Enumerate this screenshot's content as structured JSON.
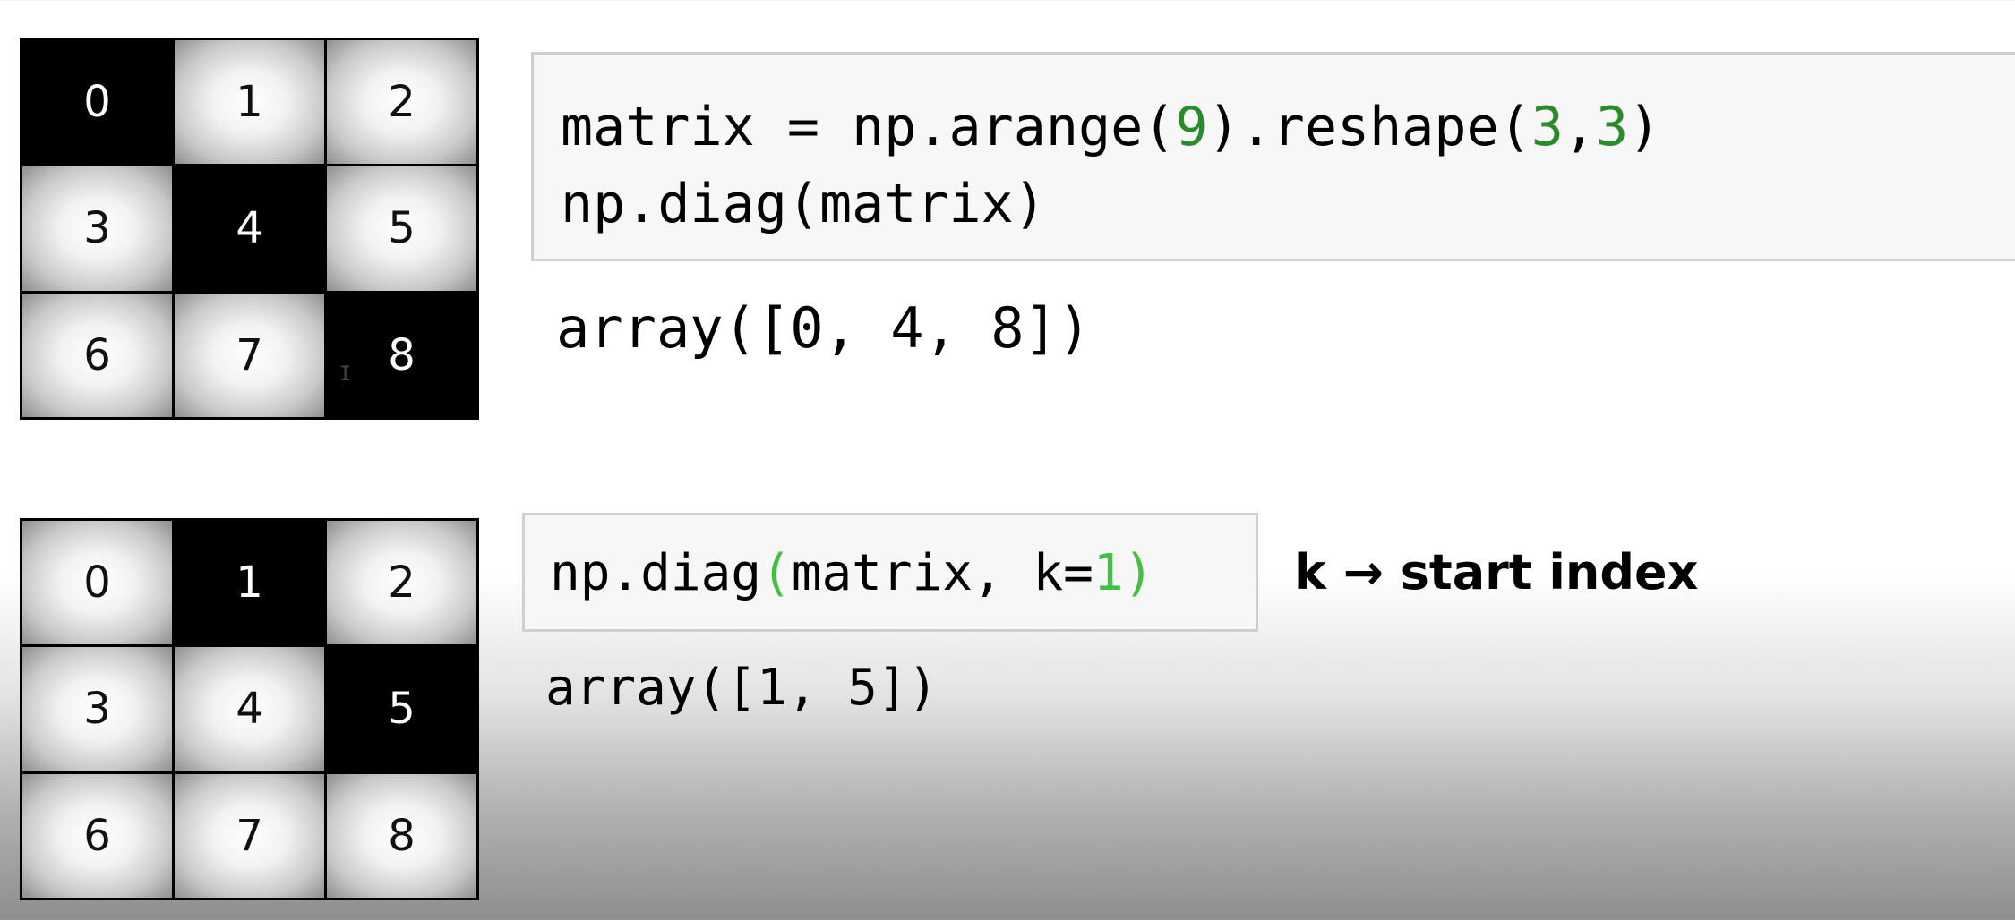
{
  "grid_a": {
    "cells": [
      {
        "label": "0",
        "highlighted": true
      },
      {
        "label": "1",
        "highlighted": false
      },
      {
        "label": "2",
        "highlighted": false
      },
      {
        "label": "3",
        "highlighted": false
      },
      {
        "label": "4",
        "highlighted": true
      },
      {
        "label": "5",
        "highlighted": false
      },
      {
        "label": "6",
        "highlighted": false
      },
      {
        "label": "7",
        "highlighted": false
      },
      {
        "label": "8",
        "highlighted": true
      }
    ]
  },
  "grid_b": {
    "cells": [
      {
        "label": "0",
        "highlighted": false
      },
      {
        "label": "1",
        "highlighted": true
      },
      {
        "label": "2",
        "highlighted": false
      },
      {
        "label": "3",
        "highlighted": false
      },
      {
        "label": "4",
        "highlighted": false
      },
      {
        "label": "5",
        "highlighted": true
      },
      {
        "label": "6",
        "highlighted": false
      },
      {
        "label": "7",
        "highlighted": false
      },
      {
        "label": "8",
        "highlighted": false
      }
    ]
  },
  "cursor_icon": "text-cursor-icon",
  "cell_a": {
    "line1": {
      "pre": "matrix = np.arange(",
      "n1": "9",
      "mid": ").reshape(",
      "n2": "3",
      "comma": ",",
      "n3": "3",
      "post": ")"
    },
    "line2": "np.diag(matrix)",
    "output": "array([0, 4, 8])"
  },
  "cell_b": {
    "code": {
      "pre": "np.diag",
      "open": "(",
      "mid": "matrix, k=",
      "k": "1",
      "close": ")"
    },
    "output": "array([1, 5])"
  },
  "annotation": "k → start index",
  "colors": {
    "number": "#2a8b2a",
    "bracket_highlight": "#43c043",
    "highlight_cell": "#000000"
  }
}
